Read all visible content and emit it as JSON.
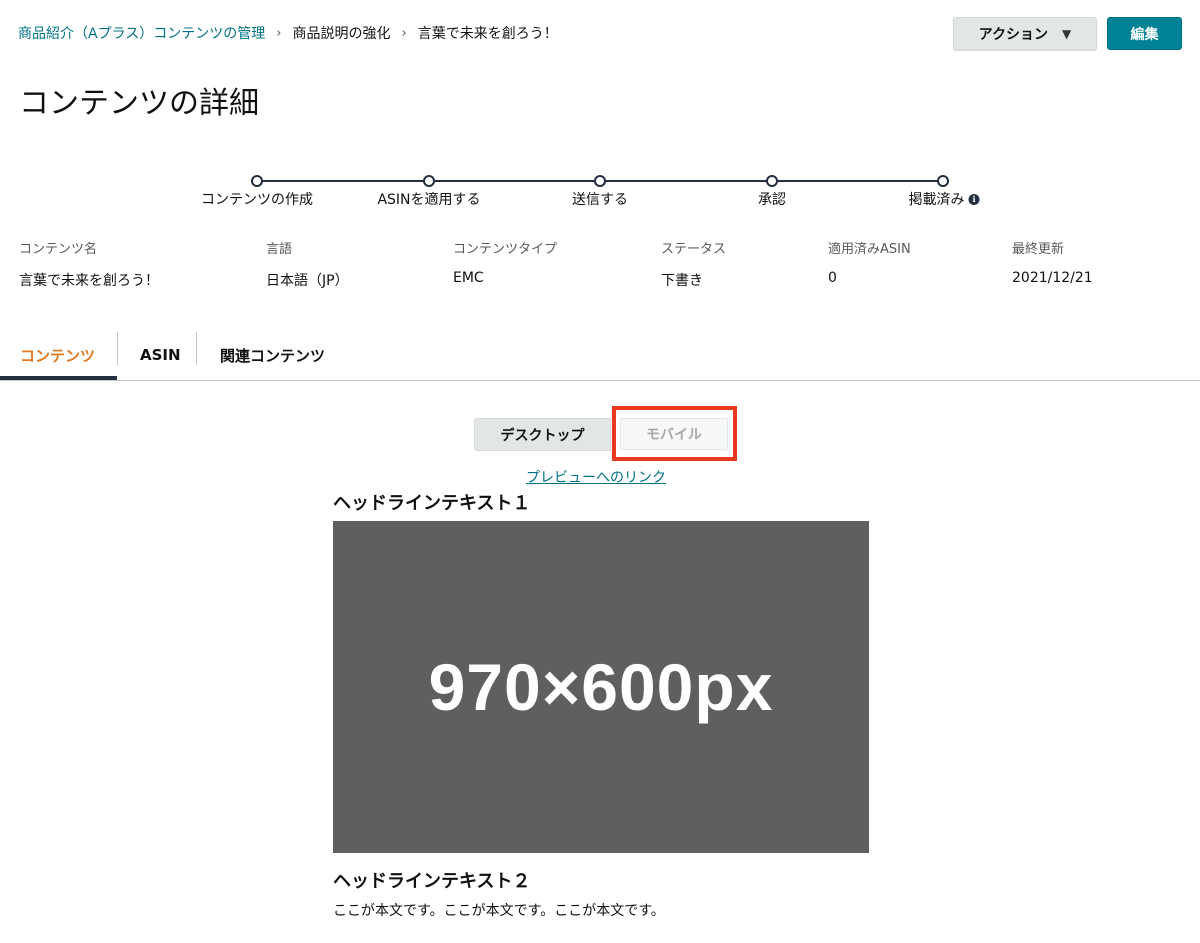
{
  "breadcrumb": {
    "link": "商品紹介（Aプラス）コンテンツの管理",
    "crumb_2": "商品説明の強化",
    "crumb_3": "言葉で未来を創ろう！",
    "separator": "›"
  },
  "header": {
    "action_label": "アクション",
    "action_caret": "▼",
    "edit_label": "編集"
  },
  "page_title": "コンテンツの詳細",
  "stepper": {
    "steps": [
      "コンテンツの作成",
      "ASINを適用する",
      "送信する",
      "承認",
      "掲載済み"
    ],
    "info_icon_glyph": "i"
  },
  "meta": {
    "labels": [
      "コンテンツ名",
      "言語",
      "コンテンツタイプ",
      "ステータス",
      "適用済みASIN",
      "最終更新"
    ],
    "values": [
      "言葉で未来を創ろう！",
      "日本語（JP）",
      "EMC",
      "下書き",
      "0",
      "2021/12/21"
    ]
  },
  "tabs": [
    {
      "label": "コンテンツ",
      "active": true
    },
    {
      "label": "ASIN",
      "active": false
    },
    {
      "label": "関連コンテンツ",
      "active": false
    }
  ],
  "preview": {
    "desktop_label": "デスクトップ",
    "mobile_label": "モバイル",
    "link_label": "プレビューへのリンク"
  },
  "content": {
    "headline_1": "ヘッドラインテキスト１",
    "image_label": "970×600px",
    "headline_2": "ヘッドラインテキスト２",
    "body": "ここが本文です。ここが本文です。ここが本文です。"
  },
  "colors": {
    "link": "#007185",
    "edit_button": "#008296",
    "active_tab": "#e3771e",
    "highlight": "#e8391e",
    "image_bg": "#5f5f5f"
  }
}
